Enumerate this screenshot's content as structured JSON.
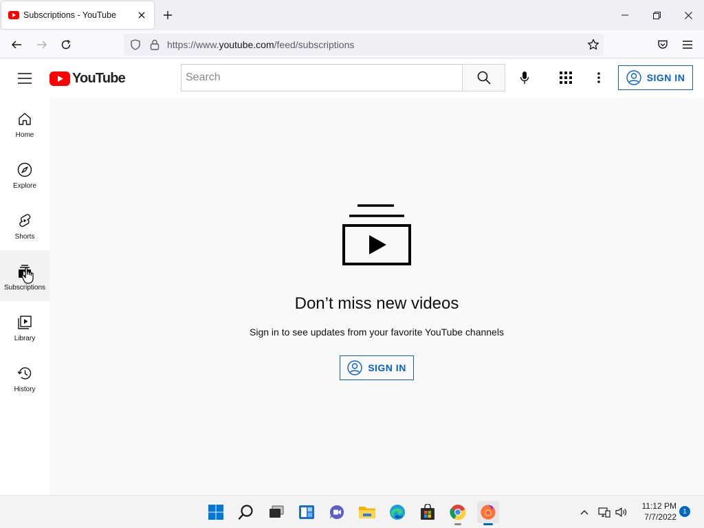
{
  "browser": {
    "tab_title": "Subscriptions - YouTube",
    "url_prefix": "https://www.",
    "url_host": "youtube.com",
    "url_path": "/feed/subscriptions"
  },
  "masthead": {
    "logo_text": "YouTube",
    "search_placeholder": "Search",
    "signin_label": "SIGN IN"
  },
  "guide": {
    "items": [
      {
        "label": "Home",
        "icon": "home-icon"
      },
      {
        "label": "Explore",
        "icon": "compass-icon"
      },
      {
        "label": "Shorts",
        "icon": "shorts-icon"
      },
      {
        "label": "Subscriptions",
        "icon": "subscriptions-icon",
        "active": true
      },
      {
        "label": "Library",
        "icon": "library-icon"
      },
      {
        "label": "History",
        "icon": "history-icon"
      }
    ]
  },
  "main": {
    "title": "Don’t miss new videos",
    "subtitle": "Sign in to see updates from your favorite YouTube channels",
    "signin_label": "SIGN IN"
  },
  "taskbar": {
    "time": "11:12 PM",
    "date": "7/7/2022",
    "notification_count": "1"
  },
  "colors": {
    "brand_red": "#ff0000",
    "link_blue": "#065fd4",
    "windows_accent": "#0067c0"
  }
}
